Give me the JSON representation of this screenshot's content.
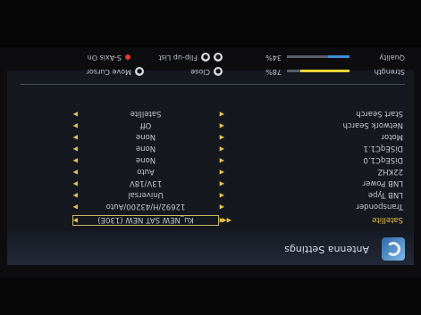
{
  "header": {
    "title": "Antenna Settings"
  },
  "rows": [
    {
      "label": "Satellite",
      "value": "Ku_NEW SAT NEW (130E)"
    },
    {
      "label": "Transponder",
      "value": "12692/H/43200/Auto"
    },
    {
      "label": "LNB Type",
      "value": "Universal"
    },
    {
      "label": "LNB Power",
      "value": "13V/18V"
    },
    {
      "label": "22KHZ",
      "value": "Auto"
    },
    {
      "label": "DiSEqC1.0",
      "value": "None"
    },
    {
      "label": "DiSEqC1.1",
      "value": "None"
    },
    {
      "label": "Motor",
      "value": "None"
    },
    {
      "label": "Network Search",
      "value": "Off"
    },
    {
      "label": "Start Search",
      "value": "Satellite"
    }
  ],
  "meters": {
    "strength": {
      "label": "Strength",
      "percent": "78%",
      "level": 0.78,
      "color": "#e8d23a"
    },
    "quality": {
      "label": "Quality",
      "percent": "34%",
      "level": 0.34,
      "color": "#3a8fd6"
    }
  },
  "legend": {
    "move_cursor": "Move Cursor",
    "close": "Close",
    "flip": "Flip-up List",
    "s_axis": "S-Axis On"
  },
  "icons": {
    "arrow_left": "◀",
    "arrow_right": "▶",
    "double_left": "◀◀"
  }
}
